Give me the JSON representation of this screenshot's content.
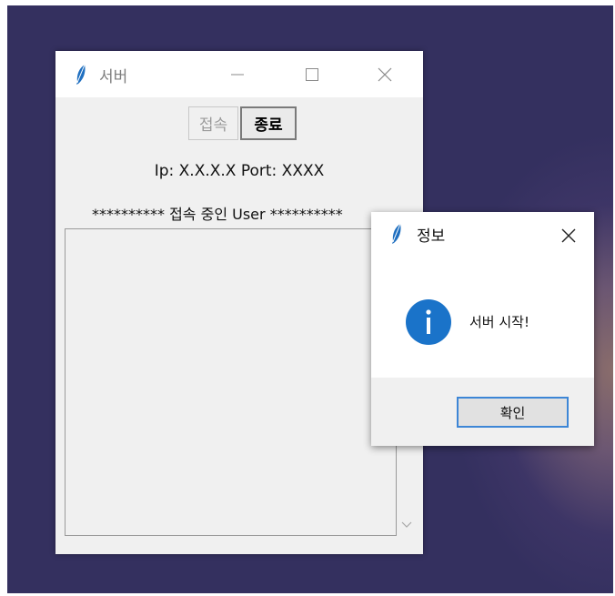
{
  "main_window": {
    "title": "서버",
    "connect_button": "접속",
    "exit_button": "종료",
    "ip_label": "Ip: X.X.X.X  Port: XXXX",
    "user_header": "********** 접속 중인 User **********",
    "users": []
  },
  "dialog": {
    "title": "정보",
    "message": "서버 시작!",
    "ok_button": "확인",
    "icon": "info-icon"
  },
  "colors": {
    "desktop": "#34305f",
    "info_blue": "#1a73c9",
    "focus_blue": "#3d86d6",
    "window_bg": "#f0f0f0"
  }
}
